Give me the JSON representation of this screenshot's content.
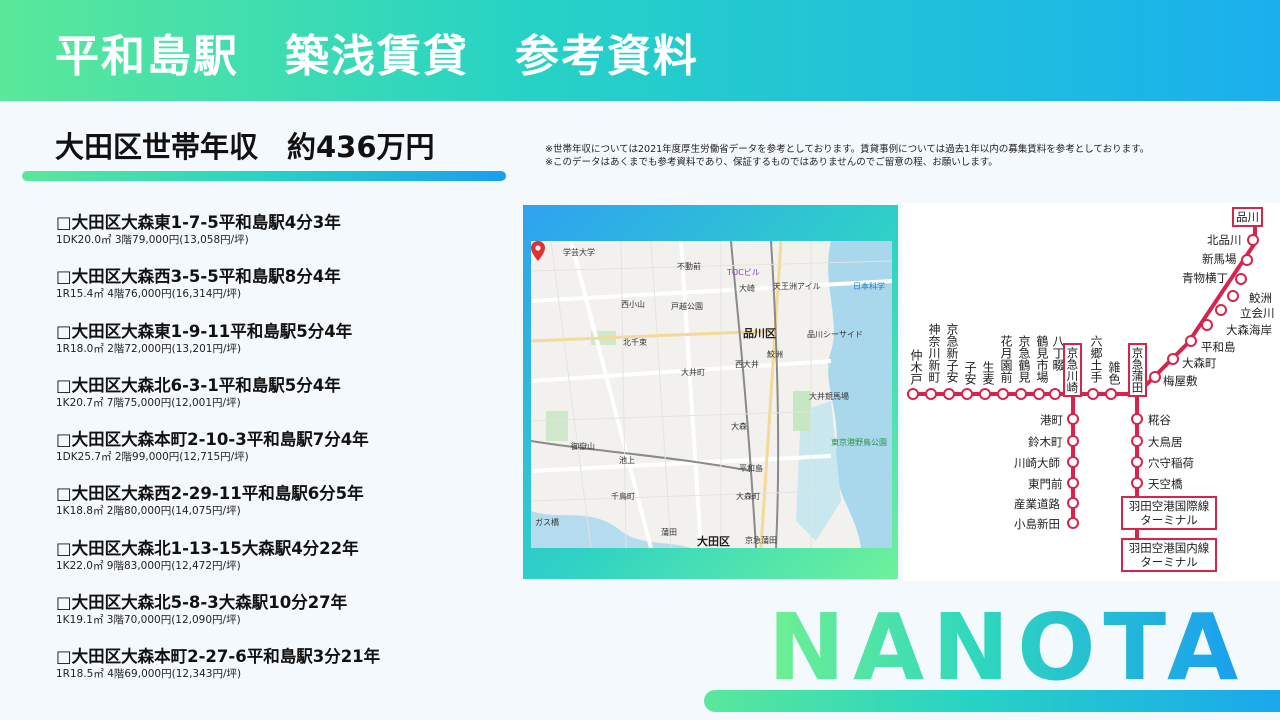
{
  "header": {
    "title": "平和島駅　築浅賃貸　参考資料"
  },
  "summary": {
    "label": "大田区世帯年収　約436万円"
  },
  "notes": [
    "※世帯年収については2021年度厚生労働省データを参考としております。賃貸事例については過去1年以内の募集賃料を参考としております。",
    "※このデータはあくまでも参考資料であり、保証するものではありませんのでご留意の程、お願いします。"
  ],
  "listings": [
    {
      "title": "□大田区大森東1-7-5平和島駅4分3年",
      "detail": "1DK20.0㎡ 3階79,000円(13,058円/坪)"
    },
    {
      "title": "□大田区大森西3-5-5平和島駅8分4年",
      "detail": "1R15.4㎡ 4階76,000円(16,314円/坪)"
    },
    {
      "title": "□大田区大森東1-9-11平和島駅5分4年",
      "detail": "1R18.0㎡ 2階72,000円(13,201円/坪)"
    },
    {
      "title": "□大田区大森北6-3-1平和島駅5分4年",
      "detail": "1K20.7㎡ 7階75,000円(12,001円/坪)"
    },
    {
      "title": "□大田区大森本町2-10-3平和島駅7分4年",
      "detail": "1DK25.7㎡ 2階99,000円(12,715円/坪)"
    },
    {
      "title": "□大田区大森西2-29-11平和島駅6分5年",
      "detail": "1K18.8㎡ 2階80,000円(14,075円/坪)"
    },
    {
      "title": "□大田区大森北1-13-15大森駅4分22年",
      "detail": "1K22.0㎡ 9階83,000円(12,472円/坪)"
    },
    {
      "title": "□大田区大森北5-8-3大森駅10分27年",
      "detail": "1K19.1㎡ 3階70,000円(12,090円/坪)"
    },
    {
      "title": "□大田区大森本町2-27-6平和島駅3分21年",
      "detail": "1R18.5㎡ 4階69,000円(12,343円/坪)"
    }
  ],
  "map": {
    "labels": {
      "gakugei": "学芸大学",
      "fudomae": "不動前",
      "tocbldg": "TOCビル",
      "osaki": "大崎",
      "shinagawa_ku": "品川区",
      "nishikoyama": "西小山",
      "togoshi": "戸越公園",
      "kitasenzoku": "北千束",
      "nishioi": "西大井",
      "oimachi": "大井町",
      "tennozu": "天王洲アイル",
      "shinagawa_seaside": "品川シーサイド",
      "samezu": "鮫洲",
      "oi_keibajo": "大井競馬場",
      "ikegami": "池上",
      "heiwajima": "平和島",
      "omori": "大森",
      "omorimachi": "大森町",
      "kamata": "蒲田",
      "ota_ku": "大田区",
      "keikyu_kamata": "京急蒲田",
      "nihon_kagaku": "日本科学",
      "ontakesan": "御嶽山",
      "chidoricho": "千鳥町",
      "tokyoport_bird": "東京港野鳥公園",
      "gasubashi": "ガス橋"
    }
  },
  "route": {
    "top_stations": [
      "仲木戸",
      "神奈川新町",
      "京急新子安",
      "子安",
      "生麦",
      "花月園前",
      "京急鶴見",
      "鶴見市場",
      "八丁畷",
      "京急川崎",
      "六郷土手",
      "雑色",
      "京急蒲田"
    ],
    "diagonal_stations": [
      "品川",
      "北品川",
      "新馬場",
      "青物横丁",
      "鮫洲",
      "立会川",
      "大森海岸",
      "平和島",
      "大森町",
      "梅屋敷"
    ],
    "daishi_line": [
      "港町",
      "鈴木町",
      "川崎大師",
      "東門前",
      "産業道路",
      "小島新田"
    ],
    "airport_line": [
      "糀谷",
      "大鳥居",
      "穴守稲荷",
      "天空橋"
    ],
    "terminals": [
      "羽田空港国際線\nターミナル",
      "羽田空港国内線\nターミナル"
    ]
  },
  "brand": {
    "logo": "NANOTA"
  },
  "colors": {
    "line_red": "#d5254c",
    "accent_green": "#5ae89a",
    "accent_blue": "#1ab0ee"
  }
}
